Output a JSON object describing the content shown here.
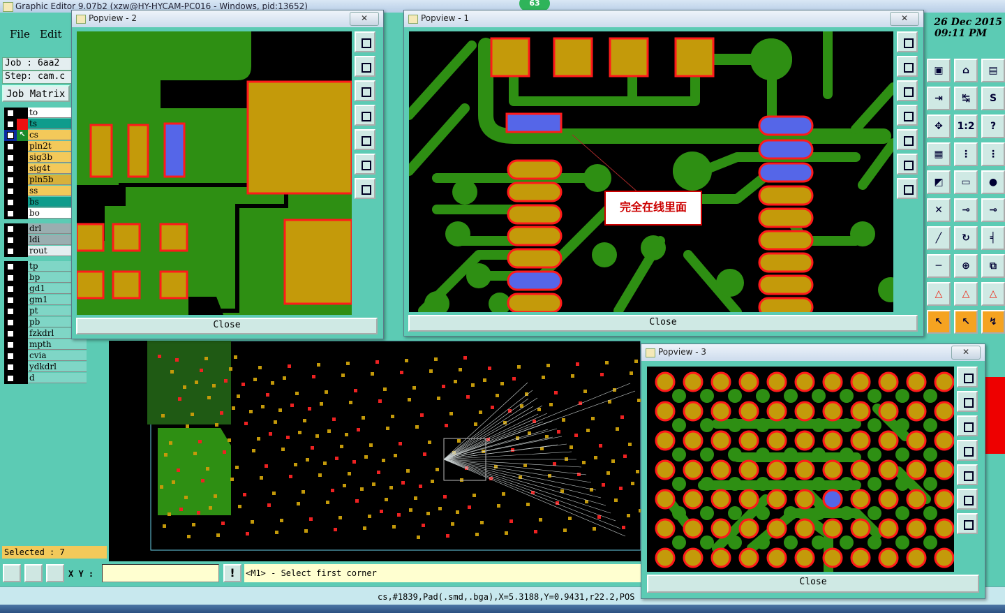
{
  "app": {
    "title": "Graphic Editor 9.07b2 (xzw@HY-HYCAM-PC016 - Windows, pid:13652)",
    "badge": "63",
    "menu": [
      "File",
      "Edit"
    ],
    "job_label": "Job : 6aa2",
    "step_label": "Step: cam.c",
    "job_matrix": "Job Matrix",
    "date": "26 Dec 2015",
    "time": "09:11 PM",
    "selected": "Selected : 7",
    "xy_label": "X Y :",
    "xy_value": "",
    "prompt": "<M1> - Select first corner",
    "status": "cs,#1839,Pad(.smd,.bga),X=5.3188,Y=0.9431,r22.2,POS"
  },
  "colors": {
    "board_bg": "#000000",
    "copper": "#2e8f13",
    "pad": "#c49a0a",
    "pad_outline": "#ff1a1a",
    "selected_pad": "#5566e8",
    "panel": "#5ccbb4"
  },
  "layers": [
    {
      "name": "to",
      "color": "#ffffff",
      "mark": ""
    },
    {
      "name": "ts",
      "color": "#0f9c8c",
      "mark": "red"
    },
    {
      "name": "cs",
      "color": "#f3c95a",
      "mark": "active"
    },
    {
      "name": "pln2t",
      "color": "#f3c95a",
      "mark": ""
    },
    {
      "name": "sig3b",
      "color": "#f3c95a",
      "mark": ""
    },
    {
      "name": "sig4t",
      "color": "#f3c95a",
      "mark": ""
    },
    {
      "name": "pln5b",
      "color": "#d8b13a",
      "mark": ""
    },
    {
      "name": "ss",
      "color": "#f3c95a",
      "mark": ""
    },
    {
      "name": "bs",
      "color": "#0f9c8c",
      "mark": ""
    },
    {
      "name": "bo",
      "color": "#ffffff",
      "mark": ""
    },
    {
      "name": "drl",
      "color": "#9aaeb0",
      "mark": ""
    },
    {
      "name": "ldi",
      "color": "#9aaeb0",
      "mark": ""
    },
    {
      "name": "rout",
      "color": "#e4eef0",
      "mark": ""
    },
    {
      "name": "tp",
      "color": "#7fd6c6",
      "mark": ""
    },
    {
      "name": "bp",
      "color": "#7fd6c6",
      "mark": ""
    },
    {
      "name": "gd1",
      "color": "#7fd6c6",
      "mark": ""
    },
    {
      "name": "gm1",
      "color": "#7fd6c6",
      "mark": ""
    },
    {
      "name": "pt",
      "color": "#7fd6c6",
      "mark": ""
    },
    {
      "name": "pb",
      "color": "#7fd6c6",
      "mark": ""
    },
    {
      "name": "fzkdrl",
      "color": "#7fd6c6",
      "mark": ""
    },
    {
      "name": "mpth",
      "color": "#7fd6c6",
      "mark": ""
    },
    {
      "name": "cvia",
      "color": "#7fd6c6",
      "mark": ""
    },
    {
      "name": "ydkdrl",
      "color": "#7fd6c6",
      "mark": ""
    },
    {
      "name": "d",
      "color": "#7fd6c6",
      "mark": ""
    }
  ],
  "popviews": {
    "p1": {
      "title": "Popview - 1",
      "close": "Close",
      "annotation": "完全在线里面"
    },
    "p2": {
      "title": "Popview - 2",
      "close": "Close"
    },
    "p3": {
      "title": "Popview - 3",
      "close": "Close"
    }
  },
  "toolbar_icons": [
    "save-icon",
    "home-icon",
    "window-icon",
    "import-icon",
    "step-icon",
    "s-icon",
    "move-icon",
    "scale-icon",
    "help-icon",
    "grid-icon",
    "layer-red-icon",
    "layer-pads-icon",
    "shape-icon",
    "ruler-icon",
    "dot-icon",
    "cross-icon",
    "line-dot-icon",
    "line-dot2-icon",
    "diagonal-icon",
    "rotate-icon",
    "bracket-icon",
    "minus-icon",
    "snap-icon",
    "copy-icon",
    "arc-icon",
    "arc2-icon",
    "arc3-icon",
    "pointer-icon",
    "pointer2-icon",
    "route-icon"
  ]
}
